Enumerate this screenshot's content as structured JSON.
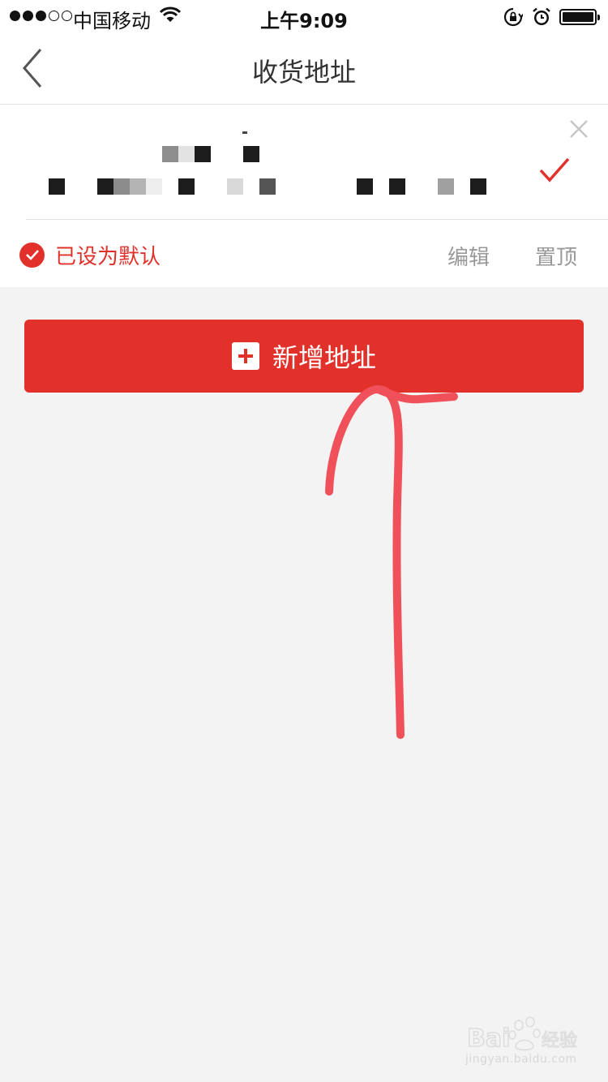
{
  "status_bar": {
    "carrier": "中国移动",
    "time": "上午9:09",
    "signal_icon": "signal-dots-icon",
    "wifi_icon": "wifi-icon",
    "orientation_lock_icon": "orientation-lock-icon",
    "alarm_icon": "alarm-clock-icon",
    "battery_icon": "battery-icon"
  },
  "nav": {
    "title": "收货地址",
    "back_icon": "chevron-left-icon"
  },
  "address_card": {
    "recipient_redacted": true,
    "address_redacted": true,
    "selected": true,
    "default_label": "已设为默认",
    "edit_label": "编辑",
    "pin_label": "置顶"
  },
  "add_button": {
    "label": "新增地址",
    "icon": "plus-square-icon"
  },
  "watermark": {
    "brand": "Baidu 经验",
    "url": "jingyan.baidu.com"
  },
  "colors": {
    "accent": "#e2302a",
    "background": "#f3f3f3",
    "annotation": "#f0505a"
  }
}
